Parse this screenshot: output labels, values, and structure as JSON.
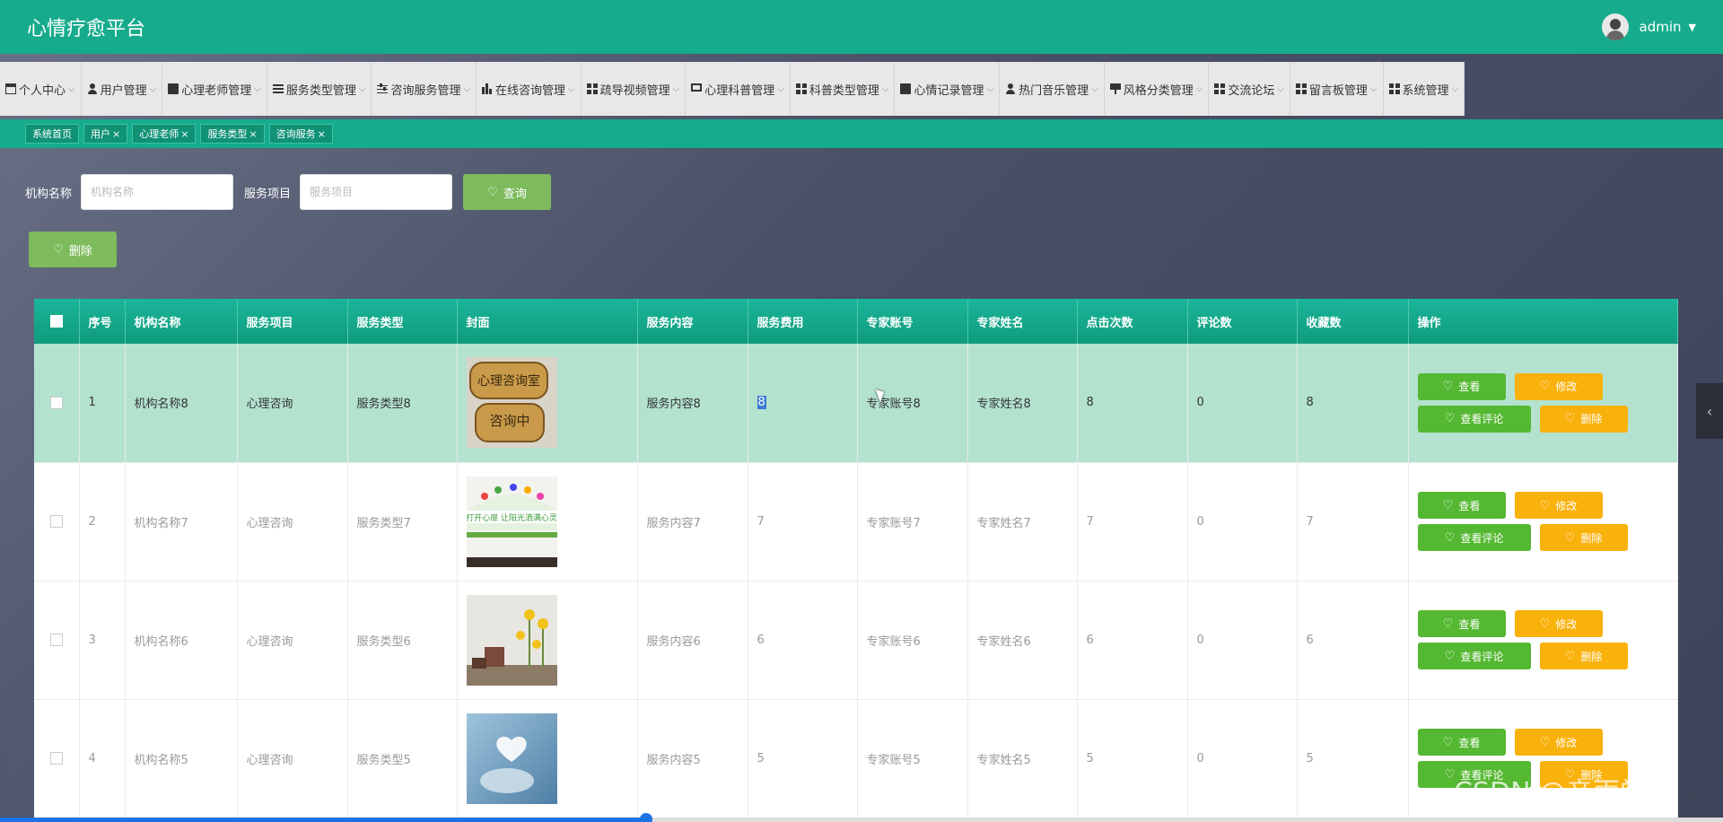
{
  "app": {
    "title": "心情疗愈平台",
    "user": "admin"
  },
  "nav": [
    {
      "label": "个人中心",
      "icon": "calendar-icon"
    },
    {
      "label": "用户管理",
      "icon": "person-icon"
    },
    {
      "label": "心理老师管理",
      "icon": "clipboard-icon"
    },
    {
      "label": "服务类型管理",
      "icon": "list-icon"
    },
    {
      "label": "咨询服务管理",
      "icon": "sliders-icon"
    },
    {
      "label": "在线咨询管理",
      "icon": "chart-icon"
    },
    {
      "label": "疏导视频管理",
      "icon": "grid-icon"
    },
    {
      "label": "心理科普管理",
      "icon": "monitor-icon"
    },
    {
      "label": "科普类型管理",
      "icon": "grid-icon"
    },
    {
      "label": "心情记录管理",
      "icon": "clipboard-icon"
    },
    {
      "label": "热门音乐管理",
      "icon": "person-icon"
    },
    {
      "label": "风格分类管理",
      "icon": "flag-icon"
    },
    {
      "label": "交流论坛",
      "icon": "grid-icon"
    },
    {
      "label": "留言板管理",
      "icon": "grid-icon"
    },
    {
      "label": "系统管理",
      "icon": "grid-icon"
    }
  ],
  "tags": [
    {
      "label": "系统首页",
      "closable": false
    },
    {
      "label": "用户",
      "closable": true
    },
    {
      "label": "心理老师",
      "closable": true
    },
    {
      "label": "服务类型",
      "closable": true
    },
    {
      "label": "咨询服务",
      "closable": true
    }
  ],
  "search": {
    "org_label": "机构名称",
    "org_placeholder": "机构名称",
    "service_label": "服务项目",
    "service_placeholder": "服务项目",
    "query_button": "查询"
  },
  "delete_button": "删除",
  "table": {
    "headers": [
      "序号",
      "机构名称",
      "服务项目",
      "服务类型",
      "封面",
      "服务内容",
      "服务费用",
      "专家账号",
      "专家姓名",
      "点击次数",
      "评论数",
      "收藏数",
      "操作"
    ],
    "rows": [
      {
        "no": "1",
        "org": "机构名称8",
        "item": "心理咨询",
        "type": "服务类型8",
        "content": "服务内容8",
        "fee": "8",
        "account": "专家账号8",
        "expert": "专家姓名8",
        "clicks": "8",
        "comments": "0",
        "favs": "8"
      },
      {
        "no": "2",
        "org": "机构名称7",
        "item": "心理咨询",
        "type": "服务类型7",
        "content": "服务内容7",
        "fee": "7",
        "account": "专家账号7",
        "expert": "专家姓名7",
        "clicks": "7",
        "comments": "0",
        "favs": "7"
      },
      {
        "no": "3",
        "org": "机构名称6",
        "item": "心理咨询",
        "type": "服务类型6",
        "content": "服务内容6",
        "fee": "6",
        "account": "专家账号6",
        "expert": "专家姓名6",
        "clicks": "6",
        "comments": "0",
        "favs": "6"
      },
      {
        "no": "4",
        "org": "机构名称5",
        "item": "心理咨询",
        "type": "服务类型5",
        "content": "服务内容5",
        "fee": "5",
        "account": "专家账号5",
        "expert": "专家姓名5",
        "clicks": "5",
        "comments": "0",
        "favs": "5"
      }
    ],
    "actions": {
      "view": "查看",
      "edit": "修改",
      "view_comments": "查看评论",
      "delete": "删除"
    }
  },
  "watermark": "CSDN @辛雨学姐",
  "colors": {
    "primary": "#16ab8c",
    "green_button": "#55b832",
    "orange_button": "#f9b10b",
    "active_row": "#b3e2cf"
  }
}
